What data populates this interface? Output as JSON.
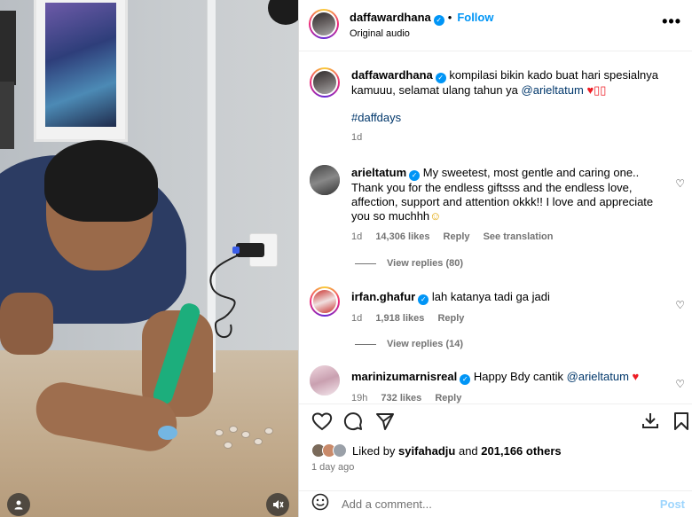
{
  "post": {
    "username": "daffawardhana",
    "follow_label": "Follow",
    "dot": "•",
    "audio": "Original audio",
    "more_label": "•••"
  },
  "caption": {
    "username": "daffawardhana",
    "text_1": "kompilasi bikin kado buat hari spesialnya kamuuu, selamat ulang tahun ya",
    "mention": "@arieltatum",
    "emoji": "♥▯▯",
    "hashtag": "#daffdays",
    "time": "1d"
  },
  "comments": [
    {
      "username": "arieltatum",
      "text": "My sweetest, most gentle and caring one.. Thank you for the endless giftsss and the endless love, affection, support and attention okkk!! I love and appreciate you so muchhh",
      "emoji": "☺",
      "time": "1d",
      "likes": "14,306 likes",
      "reply": "Reply",
      "translate": "See translation",
      "view_replies": "View replies (80)"
    },
    {
      "username": "irfan.ghafur",
      "text": "lah katanya tadi ga jadi",
      "time": "1d",
      "likes": "1,918 likes",
      "reply": "Reply",
      "view_replies": "View replies (14)"
    },
    {
      "username": "marinizumarnisreal",
      "text": "Happy Bdy cantik",
      "mention": "@arieltatum",
      "emoji": "♥",
      "time": "19h",
      "likes": "732 likes",
      "reply": "Reply"
    }
  ],
  "icons": {
    "heart": "♡",
    "comment": "◯",
    "share": "◁",
    "save": "⊓",
    "emoji": "☺",
    "download": "⤓"
  },
  "likes": {
    "prefix": "Liked by",
    "user": "syifahadju",
    "and": "and",
    "count": "201,166 others"
  },
  "ago": "1 day ago",
  "add_comment": {
    "placeholder": "Add a comment...",
    "post_label": "Post"
  },
  "colors": {
    "accent": "#0095f6",
    "heart_red": "#ed1c24"
  }
}
